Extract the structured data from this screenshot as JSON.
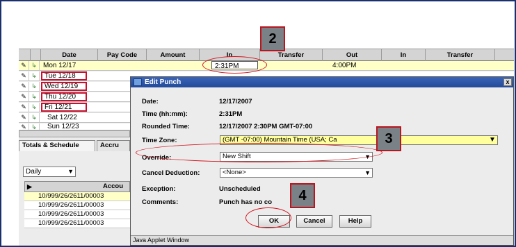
{
  "grid": {
    "headers": [
      "Date",
      "Pay Code",
      "Amount",
      "In",
      "Transfer",
      "Out",
      "In",
      "Transfer"
    ],
    "rows": [
      {
        "date": "Mon 12/17",
        "in": "2:31PM",
        "out": "4:00PM"
      },
      {
        "date": "Tue 12/18"
      },
      {
        "date": "Wed 12/19"
      },
      {
        "date": "Thu 12/20"
      },
      {
        "date": "Fri 12/21"
      },
      {
        "date": "Sat 12/22"
      },
      {
        "date": "Sun 12/23"
      }
    ]
  },
  "tabs": [
    "Totals & Schedule",
    "Accru"
  ],
  "daily": "Daily",
  "accounts": {
    "header": "Accou",
    "rows": [
      "10/999/26/2611/00003",
      "10/999/26/2611/00003",
      "10/999/26/2611/00003",
      "10/999/26/2611/00003"
    ]
  },
  "dialog": {
    "title": "Edit Punch",
    "close": "x",
    "date_label": "Date:",
    "date_value": "12/17/2007",
    "time_label": "Time (hh:mm):",
    "time_value": "2:31PM",
    "rounded_label": "Rounded Time:",
    "rounded_value": "12/17/2007 2:30PM GMT-07:00",
    "tz_label": "Time Zone:",
    "tz_value": "(GMT -07:00) Mountain Time (USA; Ca",
    "override_label": "Override:",
    "override_value": "New Shift",
    "cancel_ded_label": "Cancel Deduction:",
    "cancel_ded_value": "<None>",
    "exception_label": "Exception:",
    "exception_value": "Unscheduled",
    "comments_label": "Comments:",
    "comments_value": "Punch has no co",
    "ok": "OK",
    "cancel": "Cancel",
    "help": "Help",
    "status": "Java Applet Window"
  },
  "callouts": [
    "2",
    "3",
    "4"
  ],
  "colors": {
    "accent": "#c8102e",
    "title": "#234a9a",
    "highlight": "#ffffc8"
  }
}
